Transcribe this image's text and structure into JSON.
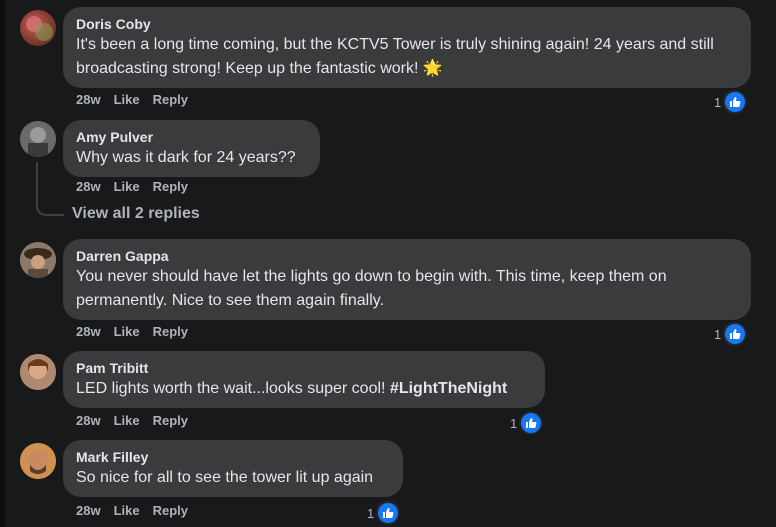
{
  "comments": [
    {
      "author": "Doris Coby",
      "text": "It's been a long time coming, but the KCTV5 Tower is truly shining again! 24 years and still broadcasting strong! Keep up the fantastic work!",
      "emoji": "🌟",
      "time": "28w",
      "like": "Like",
      "reply": "Reply",
      "reactions": "1"
    },
    {
      "author": "Amy Pulver",
      "text": "Why was it dark for 24 years??",
      "time": "28w",
      "like": "Like",
      "reply": "Reply"
    },
    {
      "author": "Darren Gappa",
      "text": "You never should have let the lights go down to begin with. This time, keep them on permanently. Nice to see them again finally.",
      "time": "28w",
      "like": "Like",
      "reply": "Reply",
      "reactions": "1"
    },
    {
      "author": "Pam Tribitt",
      "text": "LED lights worth the wait...looks super cool! ",
      "hashtag": "#LightTheNight",
      "time": "28w",
      "like": "Like",
      "reply": "Reply",
      "reactions": "1"
    },
    {
      "author": "Mark Filley",
      "text": "So nice for all to see the tower lit up again",
      "time": "28w",
      "like": "Like",
      "reply": "Reply",
      "reactions": "1"
    }
  ],
  "view_replies": "View all 2 replies",
  "colors": {
    "bubble": "#3a3b3c",
    "like_blue": "#1877f2",
    "background": "#18191a"
  }
}
